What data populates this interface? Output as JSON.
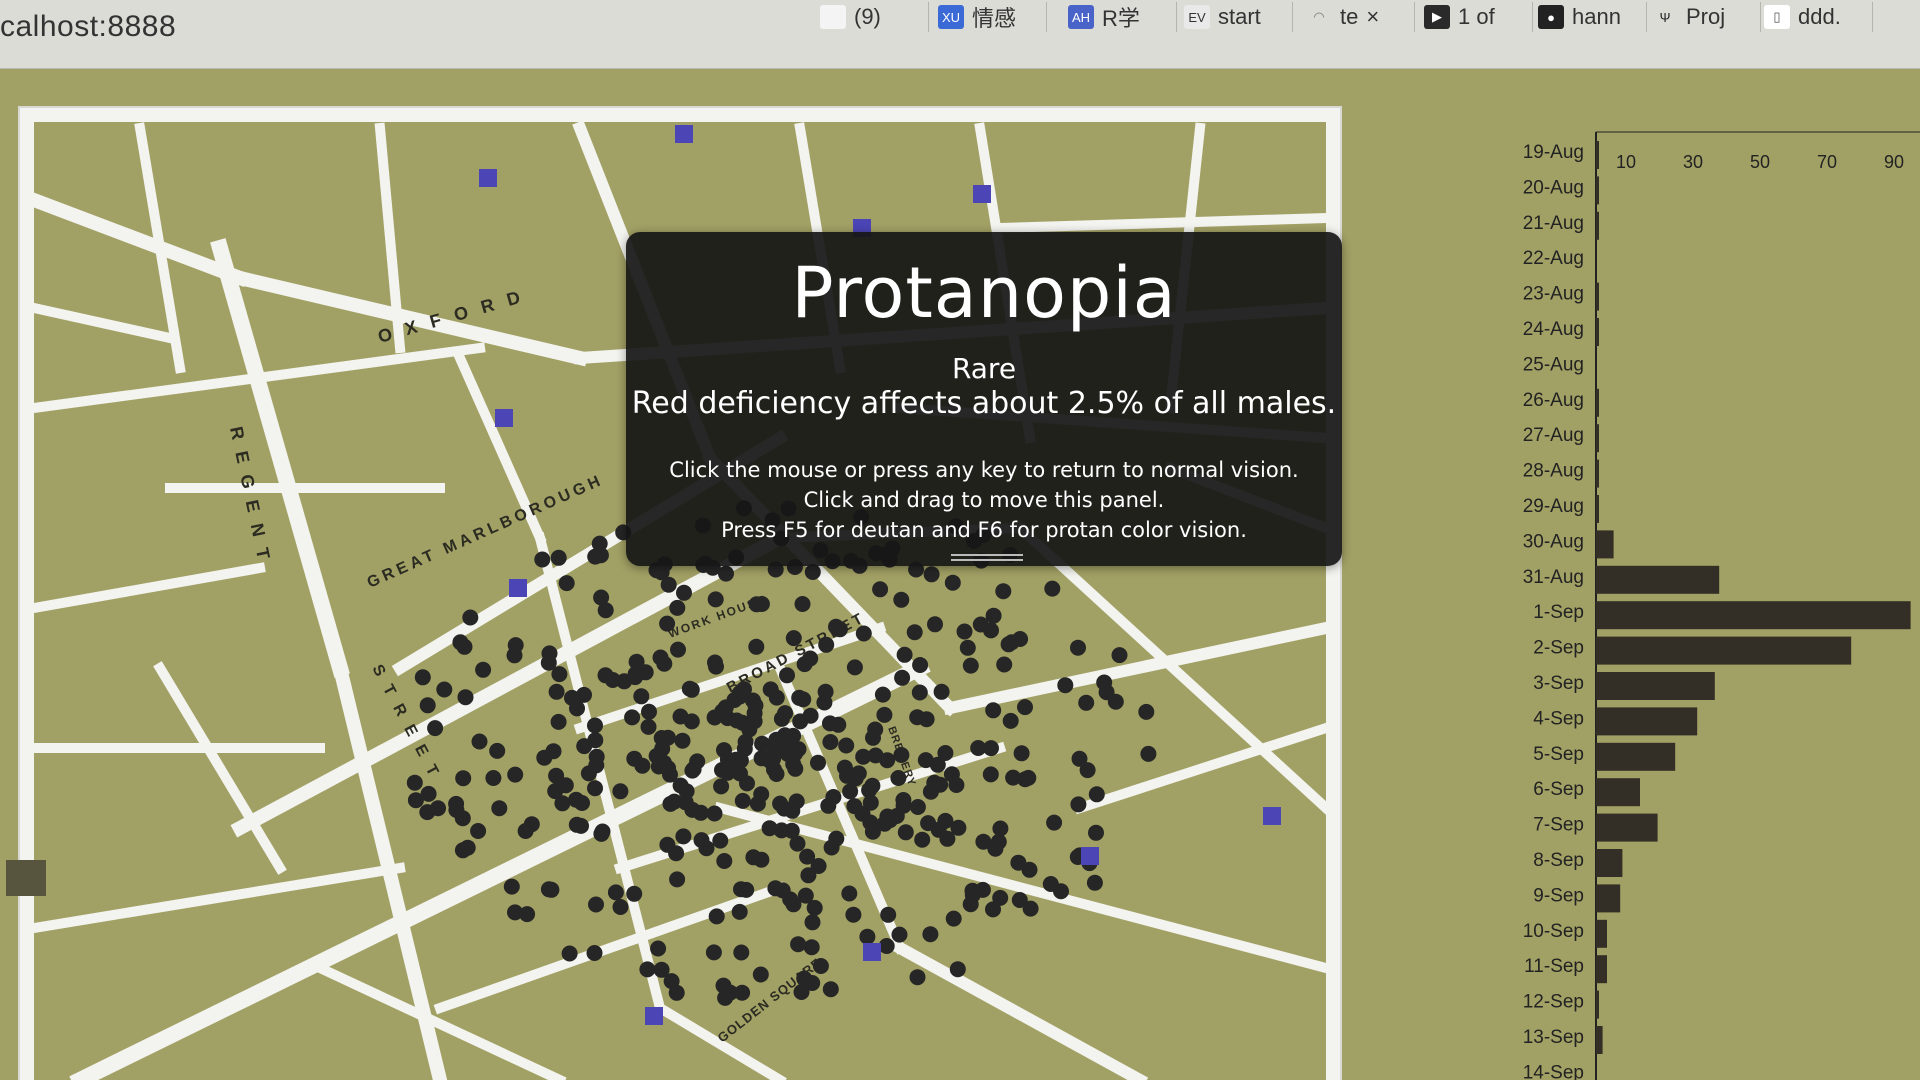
{
  "browser": {
    "url": "calhost:8888",
    "tabs": [
      {
        "label": "(9)",
        "icon": "page-icon"
      },
      {
        "label": "情感",
        "icon": "xu-icon"
      },
      {
        "label": "R学",
        "icon": "ah-icon"
      },
      {
        "label": "start",
        "icon": "evis-icon"
      },
      {
        "label": "te",
        "icon": "loading-icon",
        "closable": true
      },
      {
        "label": "1 of",
        "icon": "youtube-icon"
      },
      {
        "label": "hann",
        "icon": "github-icon"
      },
      {
        "label": "Proj",
        "icon": "trident-icon"
      },
      {
        "label": "ddd.",
        "icon": "document-icon"
      }
    ]
  },
  "map": {
    "street_labels": [
      "OXFORD",
      "REGENT",
      "GREAT MARLBOROUGH",
      "BROAD STREET",
      "STREET",
      "GOLDEN SQUARE",
      "BREWERY",
      "WORK HOUSE"
    ],
    "colors": {
      "background": "#a2a165",
      "streets": "#f3f3ef",
      "deaths": "#262626",
      "pumps": "#4b45b5"
    }
  },
  "panel": {
    "title": "Protanopia",
    "rarity": "Rare",
    "description": "Red deficiency affects about 2.5% of all males.",
    "help": [
      "Click the mouse or press any key to return to normal vision.",
      "Click and drag to move this panel.",
      "Press  F5 for deutan and F6 for protan color vision."
    ]
  },
  "chart_data": {
    "type": "bar",
    "orientation": "horizontal",
    "categories": [
      "19-Aug",
      "20-Aug",
      "21-Aug",
      "22-Aug",
      "23-Aug",
      "24-Aug",
      "25-Aug",
      "26-Aug",
      "27-Aug",
      "28-Aug",
      "29-Aug",
      "30-Aug",
      "31-Aug",
      "1-Sep",
      "2-Sep",
      "3-Sep",
      "4-Sep",
      "5-Sep",
      "6-Sep",
      "7-Sep",
      "8-Sep",
      "9-Sep",
      "10-Sep",
      "11-Sep",
      "12-Sep",
      "13-Sep",
      "14-Sep"
    ],
    "values": [
      1,
      1,
      1,
      0,
      1,
      1,
      0,
      1,
      1,
      1,
      1,
      8,
      56,
      143,
      116,
      54,
      46,
      36,
      20,
      28,
      12,
      11,
      5,
      5,
      1,
      3,
      0
    ],
    "x_ticks": [
      10,
      30,
      50,
      70,
      90
    ],
    "xlim": [
      0,
      95
    ],
    "bar_color": "#332f26"
  }
}
